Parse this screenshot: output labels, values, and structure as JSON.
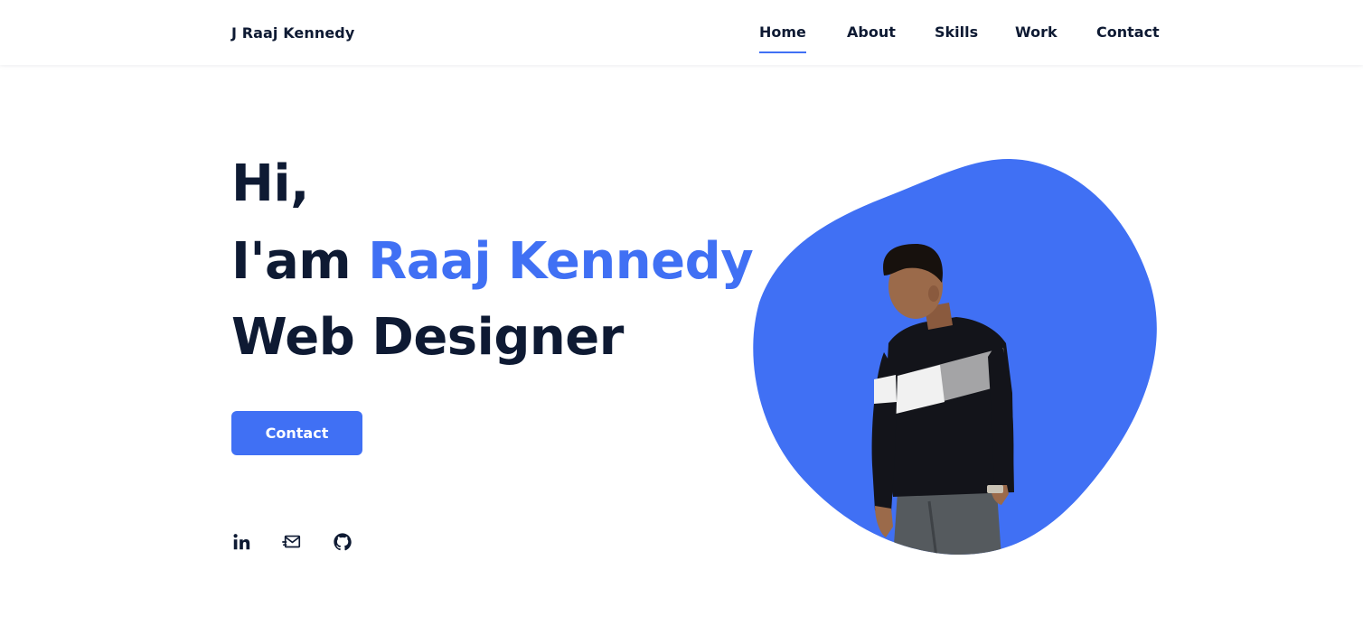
{
  "header": {
    "logo": "J Raaj Kennedy",
    "nav": [
      {
        "label": "Home",
        "active": true
      },
      {
        "label": "About",
        "active": false
      },
      {
        "label": "Skills",
        "active": false
      },
      {
        "label": "Work",
        "active": false
      },
      {
        "label": "Contact",
        "active": false
      }
    ]
  },
  "hero": {
    "greeting": "Hi,",
    "intro_prefix": "I'am ",
    "name": "Raaj Kennedy",
    "role": "Web Designer",
    "cta_label": "Contact",
    "social_icons": [
      "linkedin-icon",
      "mail-icon",
      "github-icon"
    ],
    "image": "portrait-photo"
  },
  "colors": {
    "accent": "#4070f4",
    "text_dark": "#0e1a33",
    "background": "#ffffff"
  }
}
